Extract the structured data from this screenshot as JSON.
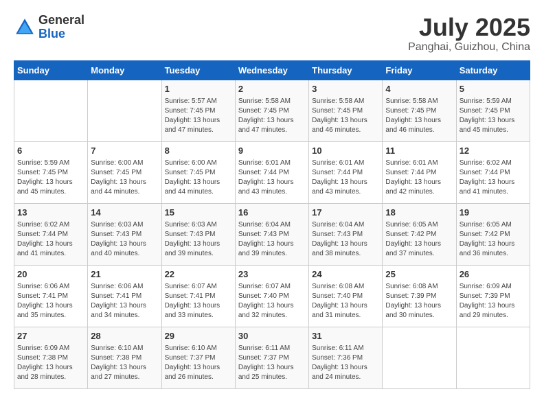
{
  "header": {
    "logo_general": "General",
    "logo_blue": "Blue",
    "title": "July 2025",
    "subtitle": "Panghai, Guizhou, China"
  },
  "columns": [
    "Sunday",
    "Monday",
    "Tuesday",
    "Wednesday",
    "Thursday",
    "Friday",
    "Saturday"
  ],
  "weeks": [
    [
      {
        "day": "",
        "info": ""
      },
      {
        "day": "",
        "info": ""
      },
      {
        "day": "1",
        "info": "Sunrise: 5:57 AM\nSunset: 7:45 PM\nDaylight: 13 hours and 47 minutes."
      },
      {
        "day": "2",
        "info": "Sunrise: 5:58 AM\nSunset: 7:45 PM\nDaylight: 13 hours and 47 minutes."
      },
      {
        "day": "3",
        "info": "Sunrise: 5:58 AM\nSunset: 7:45 PM\nDaylight: 13 hours and 46 minutes."
      },
      {
        "day": "4",
        "info": "Sunrise: 5:58 AM\nSunset: 7:45 PM\nDaylight: 13 hours and 46 minutes."
      },
      {
        "day": "5",
        "info": "Sunrise: 5:59 AM\nSunset: 7:45 PM\nDaylight: 13 hours and 45 minutes."
      }
    ],
    [
      {
        "day": "6",
        "info": "Sunrise: 5:59 AM\nSunset: 7:45 PM\nDaylight: 13 hours and 45 minutes."
      },
      {
        "day": "7",
        "info": "Sunrise: 6:00 AM\nSunset: 7:45 PM\nDaylight: 13 hours and 44 minutes."
      },
      {
        "day": "8",
        "info": "Sunrise: 6:00 AM\nSunset: 7:45 PM\nDaylight: 13 hours and 44 minutes."
      },
      {
        "day": "9",
        "info": "Sunrise: 6:01 AM\nSunset: 7:44 PM\nDaylight: 13 hours and 43 minutes."
      },
      {
        "day": "10",
        "info": "Sunrise: 6:01 AM\nSunset: 7:44 PM\nDaylight: 13 hours and 43 minutes."
      },
      {
        "day": "11",
        "info": "Sunrise: 6:01 AM\nSunset: 7:44 PM\nDaylight: 13 hours and 42 minutes."
      },
      {
        "day": "12",
        "info": "Sunrise: 6:02 AM\nSunset: 7:44 PM\nDaylight: 13 hours and 41 minutes."
      }
    ],
    [
      {
        "day": "13",
        "info": "Sunrise: 6:02 AM\nSunset: 7:44 PM\nDaylight: 13 hours and 41 minutes."
      },
      {
        "day": "14",
        "info": "Sunrise: 6:03 AM\nSunset: 7:43 PM\nDaylight: 13 hours and 40 minutes."
      },
      {
        "day": "15",
        "info": "Sunrise: 6:03 AM\nSunset: 7:43 PM\nDaylight: 13 hours and 39 minutes."
      },
      {
        "day": "16",
        "info": "Sunrise: 6:04 AM\nSunset: 7:43 PM\nDaylight: 13 hours and 39 minutes."
      },
      {
        "day": "17",
        "info": "Sunrise: 6:04 AM\nSunset: 7:43 PM\nDaylight: 13 hours and 38 minutes."
      },
      {
        "day": "18",
        "info": "Sunrise: 6:05 AM\nSunset: 7:42 PM\nDaylight: 13 hours and 37 minutes."
      },
      {
        "day": "19",
        "info": "Sunrise: 6:05 AM\nSunset: 7:42 PM\nDaylight: 13 hours and 36 minutes."
      }
    ],
    [
      {
        "day": "20",
        "info": "Sunrise: 6:06 AM\nSunset: 7:41 PM\nDaylight: 13 hours and 35 minutes."
      },
      {
        "day": "21",
        "info": "Sunrise: 6:06 AM\nSunset: 7:41 PM\nDaylight: 13 hours and 34 minutes."
      },
      {
        "day": "22",
        "info": "Sunrise: 6:07 AM\nSunset: 7:41 PM\nDaylight: 13 hours and 33 minutes."
      },
      {
        "day": "23",
        "info": "Sunrise: 6:07 AM\nSunset: 7:40 PM\nDaylight: 13 hours and 32 minutes."
      },
      {
        "day": "24",
        "info": "Sunrise: 6:08 AM\nSunset: 7:40 PM\nDaylight: 13 hours and 31 minutes."
      },
      {
        "day": "25",
        "info": "Sunrise: 6:08 AM\nSunset: 7:39 PM\nDaylight: 13 hours and 30 minutes."
      },
      {
        "day": "26",
        "info": "Sunrise: 6:09 AM\nSunset: 7:39 PM\nDaylight: 13 hours and 29 minutes."
      }
    ],
    [
      {
        "day": "27",
        "info": "Sunrise: 6:09 AM\nSunset: 7:38 PM\nDaylight: 13 hours and 28 minutes."
      },
      {
        "day": "28",
        "info": "Sunrise: 6:10 AM\nSunset: 7:38 PM\nDaylight: 13 hours and 27 minutes."
      },
      {
        "day": "29",
        "info": "Sunrise: 6:10 AM\nSunset: 7:37 PM\nDaylight: 13 hours and 26 minutes."
      },
      {
        "day": "30",
        "info": "Sunrise: 6:11 AM\nSunset: 7:37 PM\nDaylight: 13 hours and 25 minutes."
      },
      {
        "day": "31",
        "info": "Sunrise: 6:11 AM\nSunset: 7:36 PM\nDaylight: 13 hours and 24 minutes."
      },
      {
        "day": "",
        "info": ""
      },
      {
        "day": "",
        "info": ""
      }
    ]
  ]
}
